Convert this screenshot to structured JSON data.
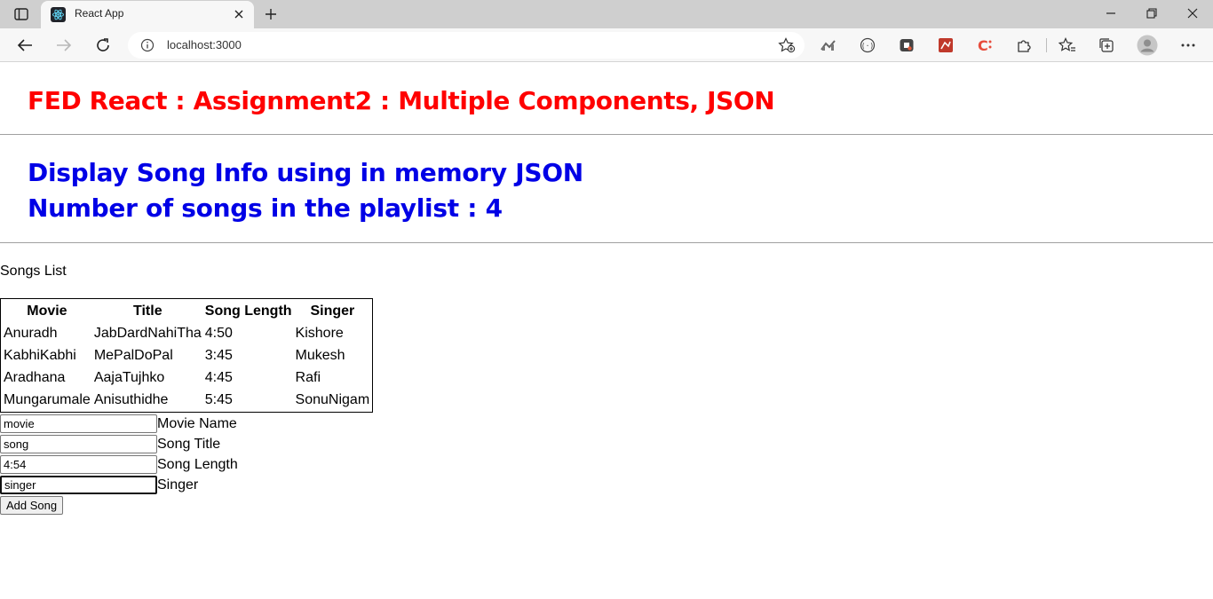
{
  "browser": {
    "tab_title": "React App",
    "url": "localhost:3000"
  },
  "header": {
    "title": "FED React : Assignment2 : Multiple Components, JSON",
    "subtitle_line1": "Display Song Info using in memory JSON",
    "subtitle_line2": "Number of songs in the playlist : 4"
  },
  "songs": {
    "label": "Songs List",
    "columns": [
      "Movie",
      "Title",
      "Song Length",
      "Singer"
    ],
    "rows": [
      [
        "Anuradh",
        "JabDardNahiTha",
        "4:50",
        "Kishore"
      ],
      [
        "KabhiKabhi",
        "MePalDoPal",
        "3:45",
        "Mukesh"
      ],
      [
        "Aradhana",
        "AajaTujhko",
        "4:45",
        "Rafi"
      ],
      [
        "Mungarumale",
        "Anisuthidhe",
        "5:45",
        "SonuNigam"
      ]
    ]
  },
  "form": {
    "movie": {
      "value": "movie",
      "label": "Movie Name"
    },
    "song": {
      "value": "song",
      "label": "Song Title"
    },
    "length": {
      "value": "4:54",
      "label": "Song Length"
    },
    "singer": {
      "value": "singer",
      "label": "Singer"
    },
    "submit_label": "Add Song"
  },
  "colors": {
    "title": "#ff0000",
    "subtitle": "#0000e6"
  },
  "icons": {
    "tab_actions": "tab-actions-icon",
    "favicon": "react-icon",
    "close": "close-icon",
    "new_tab": "plus-icon",
    "back": "back-arrow-icon",
    "forward": "forward-arrow-icon",
    "refresh": "refresh-icon",
    "info": "info-icon",
    "add_favorite": "star-plus-icon",
    "extensions": "puzzle-icon",
    "favorites": "favorites-icon",
    "collections": "collections-icon",
    "profile": "profile-icon",
    "menu": "more-icon"
  }
}
